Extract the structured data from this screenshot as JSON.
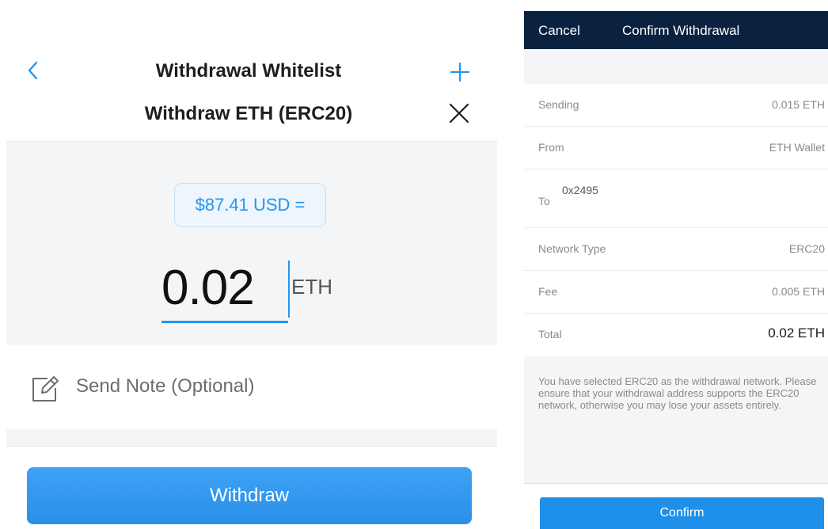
{
  "left": {
    "nav": {
      "back_icon": "chevron-left-icon",
      "title": "Withdrawal Whitelist",
      "add_icon": "plus-icon"
    },
    "sheet_title": "Withdraw ETH (ERC20)",
    "close_icon": "close-icon",
    "usd_equivalent": "$87.41 USD =",
    "amount": "0.02",
    "amount_unit": "ETH",
    "note_icon": "edit-icon",
    "note_placeholder": "Send Note (Optional)",
    "withdraw_label": "Withdraw"
  },
  "right": {
    "header": {
      "cancel_label": "Cancel",
      "title": "Confirm Withdrawal"
    },
    "rows": [
      {
        "label": "Sending",
        "value": "0.015 ETH"
      },
      {
        "label": "From",
        "value": "ETH Wallet"
      },
      {
        "label": "To",
        "value": "0x2495"
      },
      {
        "label": "Network Type",
        "value": "ERC20"
      },
      {
        "label": "Fee",
        "value": "0.005 ETH"
      },
      {
        "label": "Total",
        "value": "0.02 ETH"
      }
    ],
    "notice": "You have selected ERC20 as the withdrawal network. Please ensure that your withdrawal address supports the ERC20 network, otherwise you may lose your assets entirely.",
    "confirm_label": "Confirm"
  },
  "colors": {
    "accent": "#2196f3",
    "header_bg": "#0b2140",
    "button_blue": "#2a8fe8"
  }
}
